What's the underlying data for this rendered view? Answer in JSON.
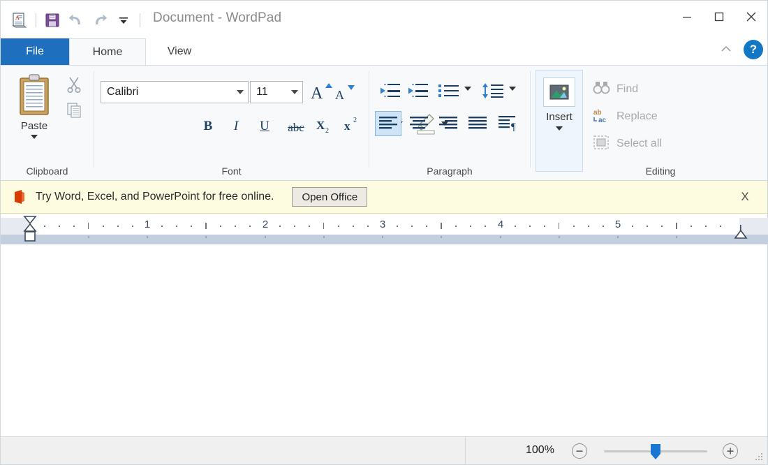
{
  "window": {
    "title": "Document - WordPad",
    "quick_access": [
      {
        "name": "wordpad-document-icon",
        "label": "WordPad"
      },
      {
        "name": "save-icon",
        "label": "Save"
      },
      {
        "name": "undo-icon",
        "label": "Undo"
      },
      {
        "name": "redo-icon",
        "label": "Redo"
      },
      {
        "name": "customize-quick-access-icon",
        "label": "Customize Quick Access Toolbar"
      }
    ],
    "controls": {
      "minimize": "Minimize",
      "maximize": "Maximize",
      "close": "Close"
    }
  },
  "tabs": [
    {
      "label": "File",
      "state": "file"
    },
    {
      "label": "Home",
      "state": "active"
    },
    {
      "label": "View",
      "state": "plain"
    }
  ],
  "ribbon_right": {
    "collapse_label": "Collapse the Ribbon",
    "help_label": "?"
  },
  "ribbon": {
    "groups": [
      {
        "name": "clipboard",
        "label": "Clipboard",
        "items": [
          {
            "label": "Paste",
            "icon": "paste-icon",
            "enabled": true,
            "dropdown": true
          },
          {
            "label": "Cut",
            "icon": "cut-icon",
            "enabled": false
          },
          {
            "label": "Copy",
            "icon": "copy-icon",
            "enabled": false
          }
        ]
      },
      {
        "name": "font",
        "label": "Font",
        "font_family": "Calibri",
        "font_size": "11",
        "items": [
          {
            "label": "Grow font",
            "icon": "grow-font-icon"
          },
          {
            "label": "Shrink font",
            "icon": "shrink-font-icon"
          },
          {
            "label": "Bold",
            "icon": "bold-icon",
            "glyph": "B"
          },
          {
            "label": "Italic",
            "icon": "italic-icon",
            "glyph": "I"
          },
          {
            "label": "Underline",
            "icon": "underline-icon",
            "glyph": "U"
          },
          {
            "label": "Strikethrough",
            "icon": "strikethrough-icon",
            "glyph": "abc"
          },
          {
            "label": "Subscript",
            "icon": "subscript-icon",
            "glyph": "X"
          },
          {
            "label": "Superscript",
            "icon": "superscript-icon",
            "glyph": "x"
          },
          {
            "label": "Text color",
            "icon": "text-color-icon",
            "dropdown": true
          },
          {
            "label": "Text highlight color",
            "icon": "highlight-icon",
            "dropdown": true
          }
        ]
      },
      {
        "name": "paragraph",
        "label": "Paragraph",
        "items": [
          {
            "label": "Decrease indent",
            "icon": "decrease-indent-icon"
          },
          {
            "label": "Increase indent",
            "icon": "increase-indent-icon"
          },
          {
            "label": "Start a list",
            "icon": "bullets-icon",
            "dropdown": true
          },
          {
            "label": "Line spacing",
            "icon": "line-spacing-icon",
            "dropdown": true
          },
          {
            "label": "Align left",
            "icon": "align-left-icon",
            "selected": true
          },
          {
            "label": "Center",
            "icon": "align-center-icon"
          },
          {
            "label": "Align right",
            "icon": "align-right-icon"
          },
          {
            "label": "Justify",
            "icon": "justify-icon"
          },
          {
            "label": "Paragraph settings",
            "icon": "paragraph-marks-icon"
          }
        ]
      },
      {
        "name": "insert",
        "label": "Insert",
        "items": [
          {
            "label": "Insert",
            "icon": "picture-icon",
            "dropdown": true
          }
        ]
      },
      {
        "name": "editing",
        "label": "Editing",
        "items": [
          {
            "label": "Find",
            "icon": "find-icon",
            "enabled": false
          },
          {
            "label": "Replace",
            "icon": "replace-icon",
            "enabled": false
          },
          {
            "label": "Select all",
            "icon": "select-all-icon",
            "enabled": false
          }
        ]
      }
    ]
  },
  "notification": {
    "icon": "office-icon",
    "message": "Try Word, Excel, and PowerPoint for free online.",
    "button_label": "Open Office",
    "close_label": "X"
  },
  "ruler": {
    "unit": "inches",
    "numbers": [
      "1",
      "2",
      "3",
      "4",
      "5"
    ],
    "left_indent_marker": "first-line-indent-marker",
    "right_indent_marker": "right-indent-marker"
  },
  "document": {
    "content": ""
  },
  "status": {
    "zoom_level": "100%",
    "zoom_out_label": "−",
    "zoom_in_label": "+",
    "slider_value": 50
  }
}
